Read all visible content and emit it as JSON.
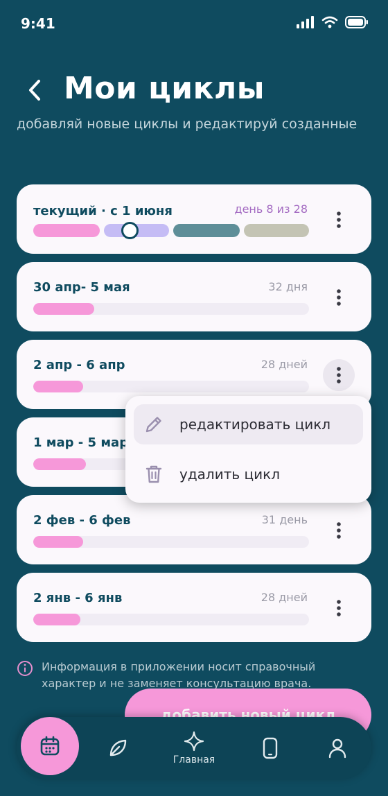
{
  "status_bar": {
    "time": "9:41"
  },
  "header": {
    "title": "Мои циклы",
    "subtitle": "добавляй новые циклы и редактируй созданные"
  },
  "cycles": [
    {
      "title": "текущий · с 1 июня",
      "meta": "день 8 из 28",
      "current": true
    },
    {
      "title": "30 апр- 5 мая",
      "meta": "32 дня",
      "fill": 0.22
    },
    {
      "title": "2 апр - 6 апр",
      "meta": "28 дней",
      "fill": 0.18
    },
    {
      "title": "1 мар - 5 мар",
      "meta": "",
      "fill": 0.19
    },
    {
      "title": "2 фев - 6 фев",
      "meta": "31 день",
      "fill": 0.18
    },
    {
      "title": "2 янв - 6 янв",
      "meta": "28 дней",
      "fill": 0.17
    }
  ],
  "phases": [
    {
      "color": "#f698d9"
    },
    {
      "color": "#c5bcf5"
    },
    {
      "color": "#5e8e98"
    },
    {
      "color": "#c4c4b4"
    }
  ],
  "context_menu": {
    "edit_label": "редактировать цикл",
    "delete_label": "удалить цикл"
  },
  "disclaimer": "Информация в приложении носит справочный характер и не заменяет консультацию врача.",
  "add_button_label": "добавить новый цикл",
  "nav": {
    "home_label": "Главная"
  },
  "colors": {
    "background": "#0f4b5f",
    "card": "#fbf8fc",
    "accent_pink": "#f698d9",
    "current_meta": "#a46bc2"
  }
}
